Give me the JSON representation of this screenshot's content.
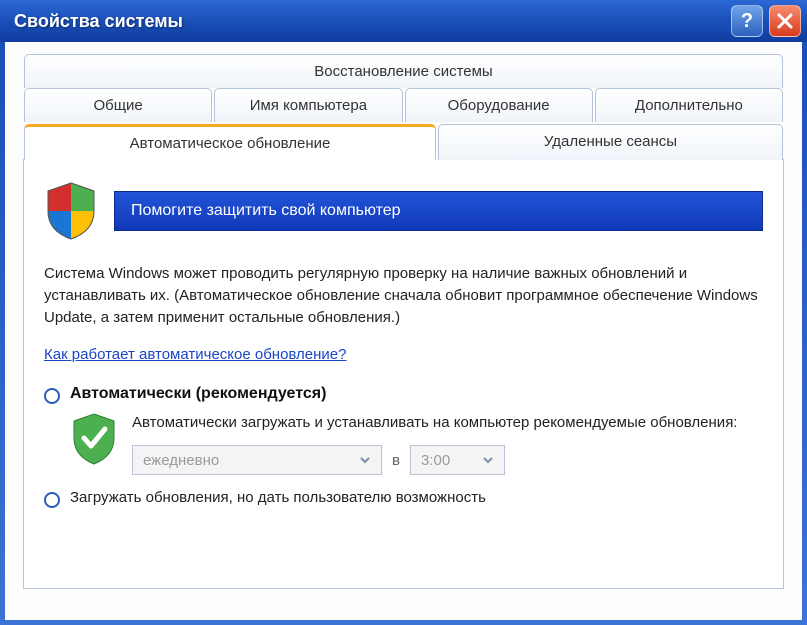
{
  "titlebar": {
    "title": "Свойства системы"
  },
  "tabs": {
    "row1": [
      {
        "label": "Восстановление системы"
      }
    ],
    "row2_top": [
      {
        "label": "Общие"
      },
      {
        "label": "Имя компьютера"
      },
      {
        "label": "Оборудование"
      },
      {
        "label": "Дополнительно"
      }
    ],
    "row3": [
      {
        "label": "Автоматическое обновление",
        "active": true
      },
      {
        "label": "Удаленные сеансы"
      }
    ]
  },
  "banner": {
    "text": "Помогите защитить свой компьютер"
  },
  "description": "Система Windows может проводить регулярную проверку на наличие важных обновлений и устанавливать их. (Автоматическое обновление сначала обновит программное обеспечение Windows Update, а затем применит остальные обновления.)",
  "link": "Как работает автоматическое обновление?",
  "option1": {
    "label": "Автоматически (рекомендуется)",
    "text": "Автоматически загружать и устанавливать на компьютер рекомендуемые обновления:",
    "schedule": {
      "frequency": "ежедневно",
      "at": "в",
      "time": "3:00"
    }
  },
  "option2": {
    "label": "Загружать обновления, но дать пользователю возможность"
  }
}
